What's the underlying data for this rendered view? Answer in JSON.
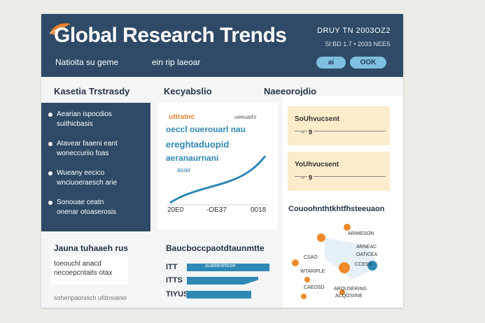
{
  "header": {
    "title": "Global Research Trends",
    "date": "DRUY TN 2003OZ2",
    "subdate": "SI:BD 1.7 • 2033 NEES",
    "nav": [
      "Natioita su geme",
      "ein rip laeoar"
    ],
    "buttons": [
      "ai",
      "OOK"
    ]
  },
  "sections": {
    "left": "Kasetia Trstrasdy",
    "middle": "Kecyabslio",
    "right": "Naeeorojdio"
  },
  "left_list": [
    {
      "line1": "Aearian ispocdios",
      "line2": "suithicbasis"
    },
    {
      "line1": "Atavear faaeni eant",
      "line2": "woneccuriio foas"
    },
    {
      "line1": "Wueany eecico",
      "line2": "wnciuoeraesch arie"
    },
    {
      "line1": "Sonouae ceatn",
      "line2": "onenar otoaserosis"
    }
  ],
  "chart_block": {
    "line1": "uttratnc",
    "line2": "ueeuarhi",
    "line3": "oeccl ouerouarl nau",
    "line4": "ereghtaduopid",
    "line5": "aeranaurnani",
    "line6": "asair",
    "tick_labels": [
      "20E0",
      "-OE37",
      "0018"
    ]
  },
  "bottom_left": {
    "title": "Jauna tuhaaeh rus",
    "line1": "toeouchl anacd",
    "line2": "necoepcntaits otax",
    "footer": "sohenpaonisch ufdosianio"
  },
  "bars": {
    "title": "Baucboccpaotdtaunmtte",
    "items": [
      {
        "label": "ITT",
        "text": "ouatilectrhcoe"
      },
      {
        "label": "ITTS",
        "text": ""
      },
      {
        "label": "TIYUS",
        "text": ""
      }
    ],
    "values": [
      0.92,
      0.8,
      0.72
    ]
  },
  "stats": [
    {
      "label": "SoUhvucsent",
      "value": "9"
    },
    {
      "label": "YoUhvucsent",
      "value": "9"
    }
  ],
  "network": {
    "title": "Couoohnthtkhtfhsteeuaon",
    "labels": [
      "ARIMESON",
      "CSAO",
      "ARNEAC",
      "OATICEA",
      "WTARIPLE",
      "CCESS",
      "CAEOSD",
      "ARQUSERING",
      "ACQOSIINE"
    ]
  },
  "colors": {
    "header_bg": "#2e4a66",
    "accent_blue": "#2f88b4",
    "pill_blue": "#7fc0e0",
    "card_yellow": "#fbeccb",
    "node_orange": "#ef8a2a"
  }
}
